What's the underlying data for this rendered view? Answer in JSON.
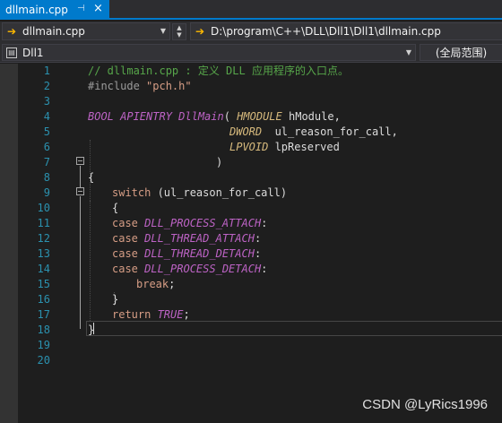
{
  "tab": {
    "title": "dllmain.cpp",
    "pin_icon": "pin-icon",
    "close_icon": "close-icon"
  },
  "navbar": {
    "file_combo": "dllmain.cpp",
    "path_combo": "D:\\program\\C++\\DLL\\Dll1\\Dll1\\dllmain.cpp"
  },
  "projbar": {
    "project": "Dll1",
    "scope": "(全局范围)"
  },
  "editor": {
    "line_numbers": [
      "1",
      "2",
      "3",
      "4",
      "5",
      "6",
      "7",
      "8",
      "9",
      "10",
      "11",
      "12",
      "13",
      "14",
      "15",
      "16",
      "17",
      "18",
      "19",
      "20"
    ],
    "l1": "// dllmain.cpp : 定义 DLL 应用程序的入口点。",
    "l2_a": "#include ",
    "l2_b": "\"pch.h\"",
    "l4_a": "BOOL",
    "l4_b": " APIENTRY ",
    "l4_c": "DllMain",
    "l4_d": "( ",
    "l4_e": "HMODULE",
    "l4_f": " hModule,",
    "l5_a": "DWORD",
    "l5_b": "  ul_reason_for_call,",
    "l6_a": "LPVOID",
    "l6_b": " lpReserved",
    "l7": ")",
    "l8": "{",
    "l9_a": "switch",
    "l9_b": " (ul_reason_for_call)",
    "l10": "{",
    "l11_a": "case ",
    "l11_b": "DLL_PROCESS_ATTACH",
    "l11_c": ":",
    "l12_a": "case ",
    "l12_b": "DLL_THREAD_ATTACH",
    "l12_c": ":",
    "l13_a": "case ",
    "l13_b": "DLL_THREAD_DETACH",
    "l13_c": ":",
    "l14_a": "case ",
    "l14_b": "DLL_PROCESS_DETACH",
    "l14_c": ":",
    "l15": "break",
    "l15_b": ";",
    "l16": "}",
    "l17_a": "return ",
    "l17_b": "TRUE",
    "l17_c": ";",
    "l18": "}"
  },
  "watermark": "CSDN @LyRics1996",
  "colors": {
    "accent": "#007acc",
    "line_number": "#2b91af",
    "comment": "#57a64a",
    "macro": "#bd63c5",
    "type": "#d7ba7d"
  }
}
